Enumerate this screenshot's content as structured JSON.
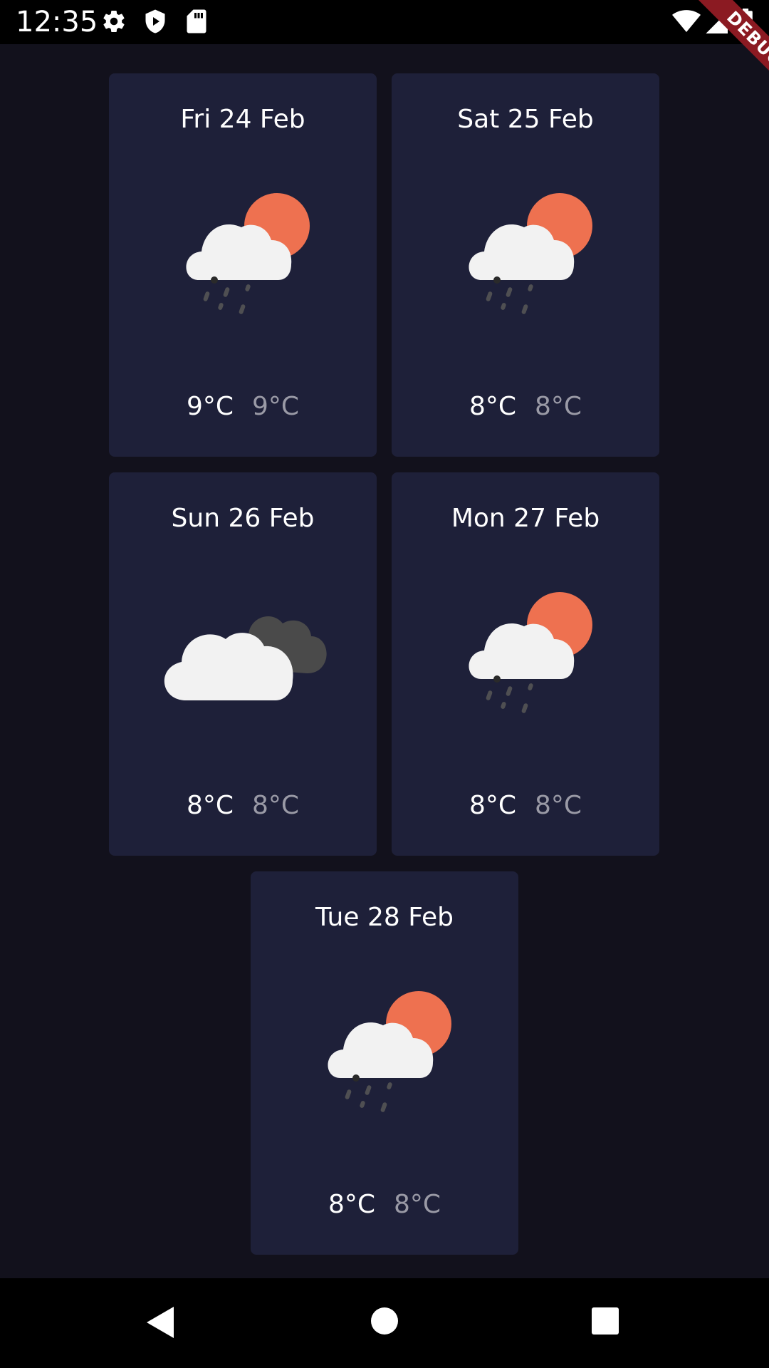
{
  "status_bar": {
    "time": "12:35",
    "left_icons": [
      "gear-icon",
      "shield-play-icon",
      "sd-card-icon"
    ],
    "right_icons": [
      "wifi-icon",
      "cell-signal-icon",
      "battery-icon"
    ]
  },
  "debug_banner": {
    "label": "DEBUG"
  },
  "forecast": [
    {
      "date": "Fri 24 Feb",
      "icon": "rain-cloud-sun-icon",
      "max": "9°C",
      "min": "9°C"
    },
    {
      "date": "Sat 25 Feb",
      "icon": "rain-cloud-sun-icon",
      "max": "8°C",
      "min": "8°C"
    },
    {
      "date": "Sun 26 Feb",
      "icon": "overcast-clouds-icon",
      "max": "8°C",
      "min": "8°C"
    },
    {
      "date": "Mon 27 Feb",
      "icon": "rain-cloud-sun-icon",
      "max": "8°C",
      "min": "8°C"
    },
    {
      "date": "Tue 28 Feb",
      "icon": "rain-cloud-sun-icon",
      "max": "8°C",
      "min": "8°C"
    }
  ],
  "nav_bar": {
    "buttons": [
      "back-icon",
      "home-icon",
      "recents-icon"
    ]
  },
  "colors": {
    "background": "#12111c",
    "card": "#1e2039",
    "sun": "#ee7150",
    "cloud": "#f2f2f2",
    "dark_cloud": "#4a4a4a",
    "temp_min": "#9a9aa6"
  }
}
